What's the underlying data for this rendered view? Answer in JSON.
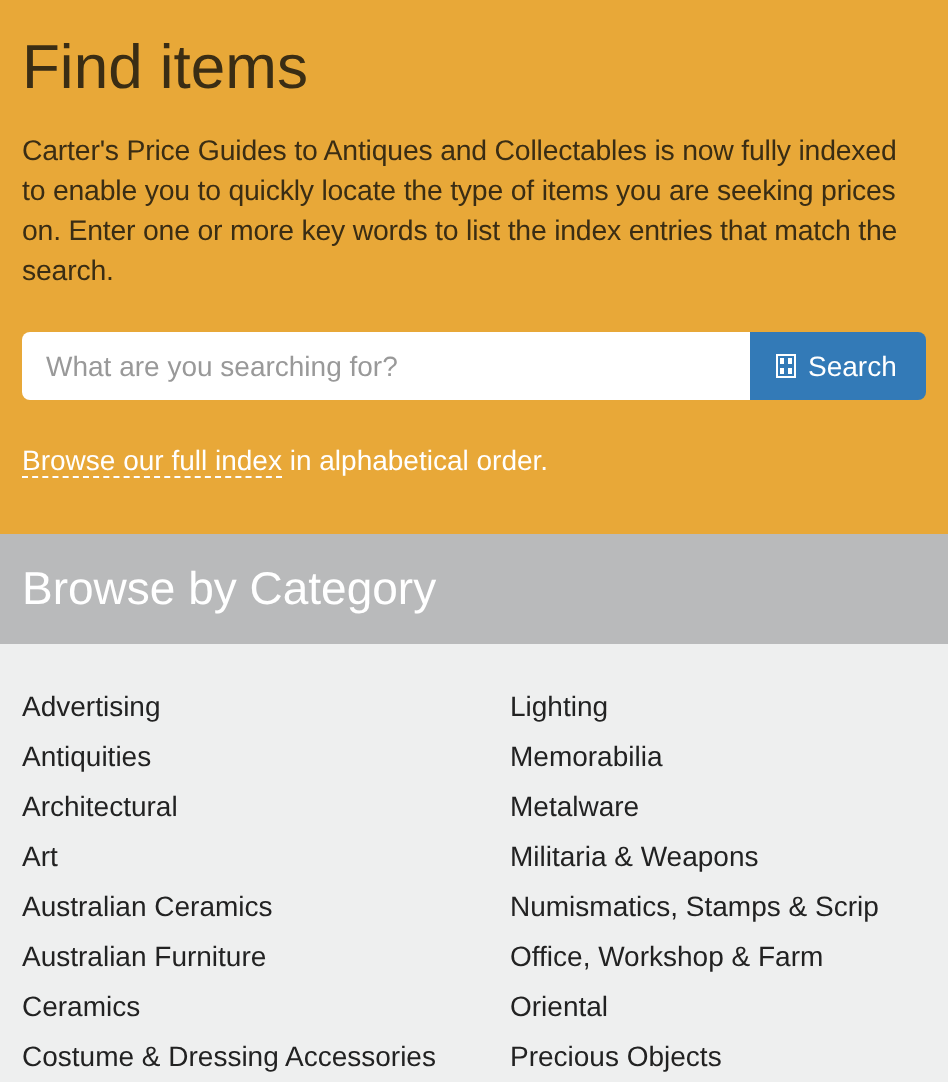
{
  "search_panel": {
    "title": "Find items",
    "intro": "Carter's Price Guides to Antiques and Collectables is now fully indexed to enable you to quickly locate the type of items you are seeking prices on. Enter one or more key words to list the index entries that match the search.",
    "search": {
      "placeholder": "What are you searching for?",
      "button": "Search"
    },
    "browse_link": "Browse our full index",
    "browse_text": "in alphabetical order."
  },
  "categories": {
    "title": "Browse by Category",
    "columns": [
      [
        "Advertising",
        "Antiquities",
        "Architectural",
        "Art",
        "Australian Ceramics",
        "Australian Furniture",
        "Ceramics",
        "Costume & Dressing Accessories"
      ],
      [
        "Lighting",
        "Memorabilia",
        "Metalware",
        "Militaria & Weapons",
        "Numismatics, Stamps & Scrip",
        "Office, Workshop & Farm",
        "Oriental",
        "Precious Objects"
      ]
    ]
  }
}
